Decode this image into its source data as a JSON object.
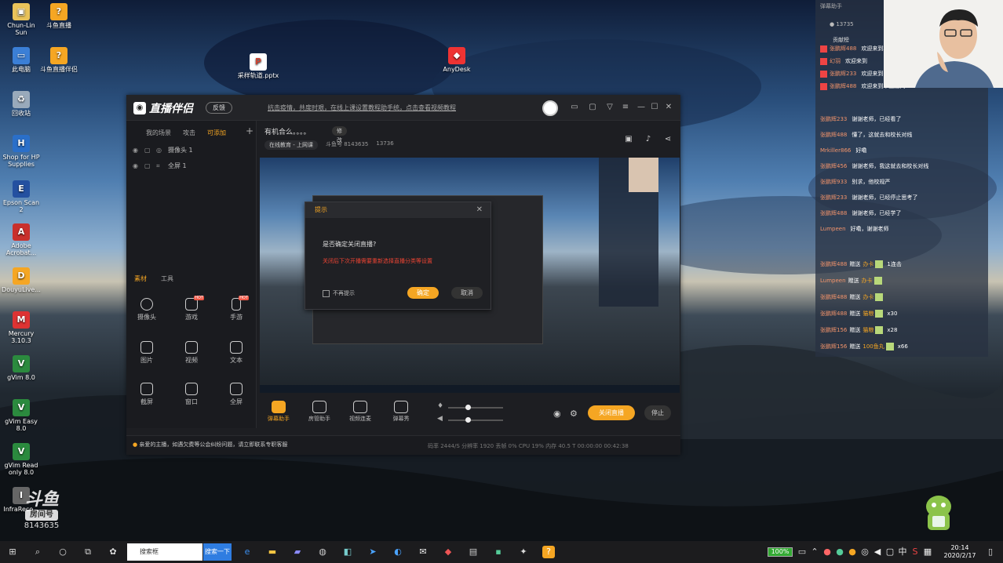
{
  "desktop": {
    "icons": [
      {
        "label": "Chun-Lin Sun",
        "icon": "user-folder-icon"
      },
      {
        "label": "此电脑",
        "icon": "computer-icon"
      },
      {
        "label": "回收站",
        "icon": "recycle-bin-icon"
      },
      {
        "label": "Shop for HP Supplies",
        "icon": "hp-shop-icon"
      },
      {
        "label": "Epson Scan 2",
        "icon": "scanner-icon"
      },
      {
        "label": "Adobe Acrobat...",
        "icon": "acrobat-icon"
      },
      {
        "label": "DouyuLive...",
        "icon": "douyu-icon"
      },
      {
        "label": "Mercury 3.10.3",
        "icon": "mercury-icon"
      },
      {
        "label": "gVim 8.0",
        "icon": "gvim-icon"
      },
      {
        "label": "gVim Easy 8.0",
        "icon": "gvim-easy-icon"
      },
      {
        "label": "gVim Read only 8.0",
        "icon": "gvim-read-icon"
      },
      {
        "label": "InfraReco...",
        "icon": "infrareco-icon"
      }
    ],
    "icons2": [
      {
        "label": "斗鱼直播",
        "icon": "douyu-live-icon"
      },
      {
        "label": "斗鱼直播伴侣",
        "icon": "douyu-companion-icon"
      },
      {
        "label": "采样轨道.pptx",
        "icon": "pptx-file-icon"
      },
      {
        "label": "AnyDesk",
        "icon": "anydesk-icon"
      }
    ],
    "watermark": {
      "logo": "斗鱼",
      "tag": "房间号",
      "room_id": "8143635"
    }
  },
  "app": {
    "title": "直播伴侣",
    "feedback": "反馈",
    "notice": "抗击疫情，共度时艰，在线上课设置教程助手统，点击查看视频教程",
    "left_tabs": [
      "我的场景",
      "攻击",
      "可添加"
    ],
    "sources": [
      {
        "label": "摄像头 1"
      },
      {
        "label": "全屏 1"
      }
    ],
    "tool_tabs": [
      "素材",
      "工具"
    ],
    "tools": [
      {
        "label": "摄像头",
        "hot": ""
      },
      {
        "label": "游戏",
        "hot": "HOT"
      },
      {
        "label": "手游",
        "hot": "HOT"
      },
      {
        "label": "图片",
        "hot": ""
      },
      {
        "label": "视频",
        "hot": ""
      },
      {
        "label": "文本",
        "hot": ""
      },
      {
        "label": "截屏",
        "hot": ""
      },
      {
        "label": "窗口",
        "hot": ""
      },
      {
        "label": "全屏",
        "hot": ""
      }
    ],
    "stream": {
      "title": "有机合么。。。。",
      "edit": "修改",
      "category": "在线教育 - 上网课",
      "room": "斗鱼号 8143635",
      "viewers": "13736"
    },
    "dialog": {
      "title": "提示",
      "question": "是否确定关闭直播?",
      "warning": "关闭后下次开播需要重新选择直播分类等设置",
      "dont_remind": "不再提示",
      "ok": "确定",
      "cancel": "取消"
    },
    "controls": [
      {
        "label": "弹幕助手",
        "active": true
      },
      {
        "label": "房管助手",
        "active": false
      },
      {
        "label": "视频连麦",
        "active": false
      },
      {
        "label": "弹幕秀",
        "active": false
      }
    ],
    "stop": "关闭直播",
    "pause": "停止",
    "footer_msg": "亲爱的主播，如遇欠费等公会纠纷问题，请立即联系专职客服",
    "footer_stats": "码率 2444/S  分辨率 1920  丢帧 0%  CPU 19%  内存 40.5 T  00:00:00  00:42:38"
  },
  "chat": {
    "header": "弹幕助手",
    "viewers": "13735",
    "gift_tab": "贡献榜",
    "messages": [
      {
        "name": "张鹏辉488",
        "text": "欢迎来到本直播间"
      },
      {
        "name": "幻羽",
        "text": "欢迎来到"
      },
      {
        "name": "张鹏辉233",
        "text": "欢迎来到"
      },
      {
        "name": "张鹏辉488",
        "text": "欢迎来到本直播间"
      },
      {
        "name": "张鹏辉233",
        "text": "谢谢老师，已经看了"
      },
      {
        "name": "张鹏辉488",
        "text": "懂了，这就去和校长对线"
      },
      {
        "name": "Mrkiller866",
        "text": "好嘞"
      },
      {
        "name": "张鹏辉456",
        "text": "谢谢老师，我这就去和校长对线"
      },
      {
        "name": "张鹏辉933",
        "text": "别求，他校规严"
      },
      {
        "name": "张鹏辉233",
        "text": "谢谢老师，已经停止思考了"
      },
      {
        "name": "张鹏辉488",
        "text": "谢谢老师，已经学了"
      },
      {
        "name": "Lumpeen",
        "text": "好嘞，谢谢老师"
      }
    ],
    "gifts": [
      {
        "name": "张鹏辉488",
        "action": "赠送",
        "gift": "办卡",
        "extra": "1连击"
      },
      {
        "name": "Lumpeen",
        "action": "赠送",
        "gift": "办卡",
        "extra": ""
      },
      {
        "name": "张鹏辉488",
        "action": "赠送",
        "gift": "办卡",
        "extra": ""
      },
      {
        "name": "张鹏辉488",
        "action": "赠送",
        "gift": "猫粮",
        "extra": "x30"
      },
      {
        "name": "张鹏辉156",
        "action": "赠送",
        "gift": "猫粮",
        "extra": "x28"
      },
      {
        "name": "张鹏辉156",
        "action": "赠送",
        "gift": "100鱼丸",
        "extra": "x66"
      }
    ]
  },
  "taskbar": {
    "search_placeholder": "搜索框",
    "search_button": "搜索一下",
    "battery": "100%",
    "time": "20:14",
    "date": "2020/2/17"
  },
  "colors": {
    "accent": "#f5a623",
    "chat_name": "#f3946b",
    "app_bg": "#1d1e22"
  }
}
